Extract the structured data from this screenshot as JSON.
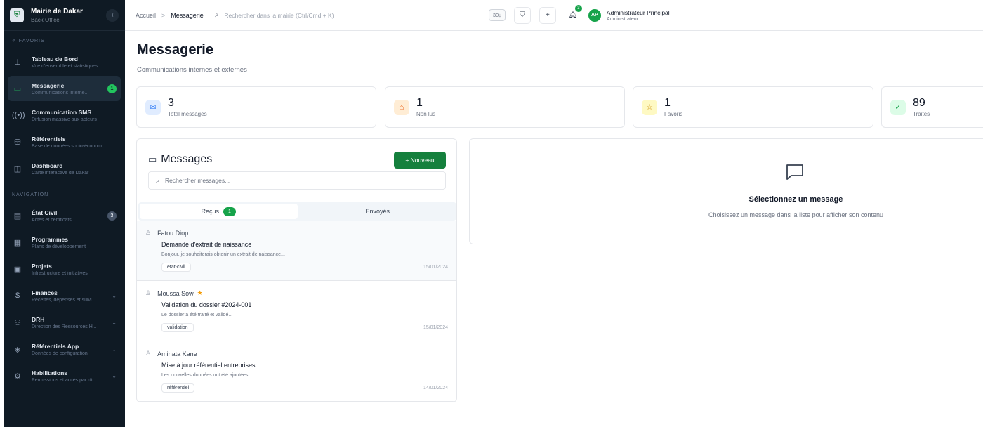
{
  "brand": {
    "title": "Mairie de Dakar",
    "subtitle": "Back Office",
    "collapse": "‹"
  },
  "sidebar": {
    "section_main": "✐ Favoris",
    "section_nav": "Navigation",
    "items_main": [
      {
        "title": "Tableau de Bord",
        "sub": "Vue d'ensemble et statistiques",
        "icon": "chart-icon",
        "glyph": "⊥"
      },
      {
        "title": "Messagerie",
        "sub": "Communications interne...",
        "icon": "chat-icon",
        "glyph": "▭",
        "badge": "1",
        "active": true
      },
      {
        "title": "Communication SMS",
        "sub": "Diffusion massive aux acteurs",
        "icon": "broadcast-icon",
        "glyph": "((•))"
      },
      {
        "title": "Référentiels",
        "sub": "Base de données socio-économ...",
        "icon": "database-icon",
        "glyph": "⛁"
      },
      {
        "title": "Dashboard",
        "sub": "Carte interactive de Dakar",
        "icon": "map-icon",
        "glyph": "◫"
      }
    ],
    "items_nav": [
      {
        "title": "État Civil",
        "sub": "Actes et certificats",
        "icon": "document-icon",
        "glyph": "▤",
        "badge": "3"
      },
      {
        "title": "Programmes",
        "sub": "Plans de développement",
        "icon": "calendar-icon",
        "glyph": "▦"
      },
      {
        "title": "Projets",
        "sub": "Infrastructure et initiatives",
        "icon": "building-icon",
        "glyph": "▣"
      },
      {
        "title": "Finances",
        "sub": "Recettes, dépenses et suivi...",
        "icon": "dollar-icon",
        "glyph": "$",
        "chevron": "⌄"
      },
      {
        "title": "DRH",
        "sub": "Direction des Ressources H...",
        "icon": "users-icon",
        "glyph": "⚇",
        "chevron": "⌄"
      },
      {
        "title": "Référentiels App",
        "sub": "Données de configuration",
        "icon": "layers-icon",
        "glyph": "◈",
        "chevron": "⌄"
      },
      {
        "title": "Habilitations",
        "sub": "Permissions et accès par rô...",
        "icon": "settings-icon",
        "glyph": "⚙",
        "chevron": "⌄"
      }
    ]
  },
  "topbar": {
    "breadcrumb_home": "Accueil",
    "breadcrumb_sep": ">",
    "breadcrumb_current": "Messagerie",
    "search_placeholder": "Rechercher dans la mairie (Ctrl/Cmd + K)",
    "kbd": "30↓",
    "filter_glyph": "⛉",
    "plus_glyph": "+",
    "bell_glyph": "🔔︎",
    "bell_badge": "3",
    "user_initials": "AP",
    "user_name": "Administrateur Principal",
    "user_role": "Administrateur"
  },
  "page": {
    "title": "Messagerie",
    "subtitle": "Communications internes et externes"
  },
  "stats": [
    {
      "value": "3",
      "label": "Total messages",
      "icon": "mail-icon",
      "glyph": "✉",
      "bg": "#e0ecff",
      "fg": "#3b82f6"
    },
    {
      "value": "1",
      "label": "Non lus",
      "icon": "inbox-icon",
      "glyph": "⌂",
      "bg": "#ffedd5",
      "fg": "#ea580c"
    },
    {
      "value": "1",
      "label": "Favoris",
      "icon": "star-icon",
      "glyph": "☆",
      "bg": "#fef9c3",
      "fg": "#ca8a04"
    },
    {
      "value": "89",
      "label": "Traités",
      "icon": "check-icon",
      "glyph": "✓",
      "bg": "#dcfce7",
      "fg": "#16a34a"
    }
  ],
  "messages": {
    "title": "Messages",
    "new_label": "+  Nouveau",
    "search_placeholder": "Rechercher messages...",
    "tabs": {
      "received": "Reçus",
      "received_badge": "1",
      "sent": "Envoyés"
    },
    "items": [
      {
        "sender": "Fatou Diop",
        "subject": "Demande d'extrait de naissance",
        "preview": "Bonjour, je souhaiterais obtenir un extrait de naissance...",
        "tag": "état-civil",
        "date": "15/01/2024",
        "starred": false
      },
      {
        "sender": "Moussa Sow",
        "subject": "Validation du dossier #2024-001",
        "preview": "Le dossier a été traité et validé...",
        "tag": "validation",
        "date": "15/01/2024",
        "starred": true
      },
      {
        "sender": "Aminata Kane",
        "subject": "Mise à jour référentiel entreprises",
        "preview": "Les nouvelles données ont été ajoutées...",
        "tag": "référentiel",
        "date": "14/01/2024",
        "starred": false
      }
    ]
  },
  "detail": {
    "title": "Sélectionnez un message",
    "subtitle": "Choisissez un message dans la liste pour afficher son contenu"
  }
}
